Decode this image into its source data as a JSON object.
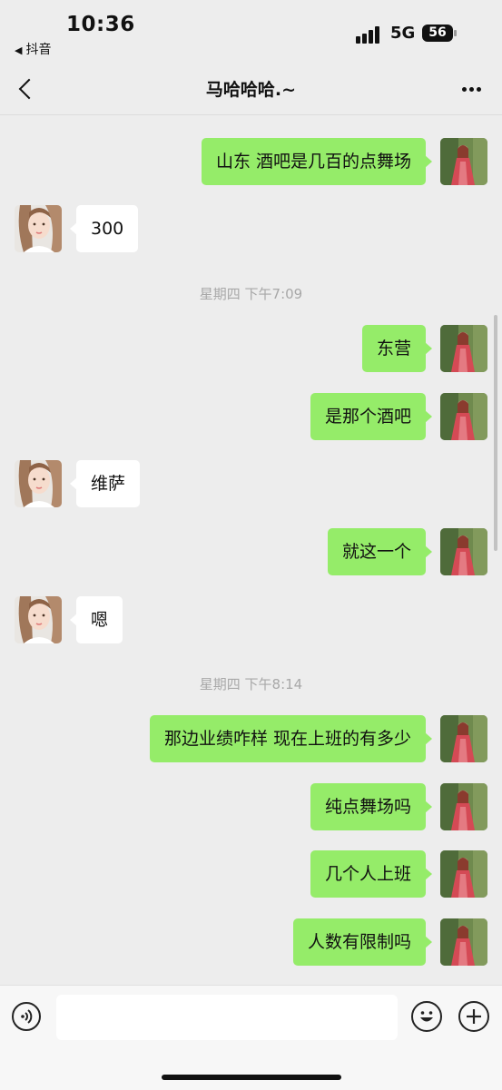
{
  "status_bar": {
    "time": "10:36",
    "back_app_label": "抖音",
    "network": "5G",
    "battery": "56"
  },
  "nav": {
    "title": "马哈哈哈.~",
    "back_icon": "chevron-left-icon",
    "more_icon": "more-horizontal-icon"
  },
  "messages": [
    {
      "sender": "self",
      "text": "山东 酒吧是几百的点舞场"
    },
    {
      "sender": "other",
      "text": "300"
    },
    {
      "timestamp": "星期四 下午7:09"
    },
    {
      "sender": "self",
      "text": "东营"
    },
    {
      "sender": "self",
      "text": "是那个酒吧"
    },
    {
      "sender": "other",
      "text": "维萨"
    },
    {
      "sender": "self",
      "text": "就这一个"
    },
    {
      "sender": "other",
      "text": "嗯"
    },
    {
      "timestamp": "星期四 下午8:14"
    },
    {
      "sender": "self",
      "text": "那边业绩咋样 现在上班的有多少"
    },
    {
      "sender": "self",
      "text": "纯点舞场吗"
    },
    {
      "sender": "self",
      "text": "几个人上班"
    },
    {
      "sender": "self",
      "text": "人数有限制吗"
    }
  ],
  "input_bar": {
    "voice_icon": "voice-icon",
    "emoji_icon": "emoji-icon",
    "plus_icon": "plus-icon",
    "placeholder": ""
  },
  "colors": {
    "self_bubble": "#95ec69",
    "other_bubble": "#ffffff",
    "background": "#ededed"
  }
}
